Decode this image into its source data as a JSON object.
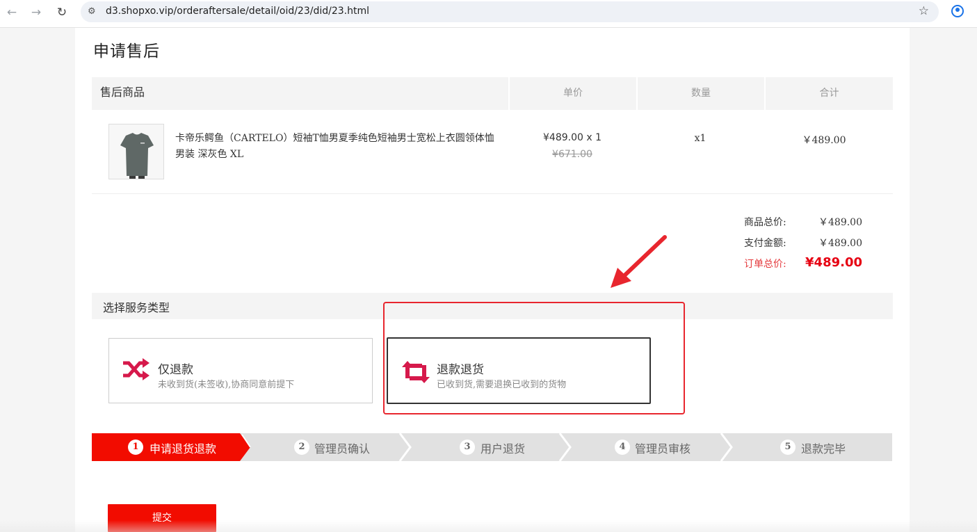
{
  "browser": {
    "url": "d3.shopxo.vip/orderaftersale/detail/oid/23/did/23.html",
    "back_icon": "arrow-left-icon",
    "forward_icon": "arrow-right-icon",
    "reload_icon": "reload-icon",
    "bookmark_icon": "star-icon",
    "profile_icon": "profile-icon"
  },
  "page": {
    "title": "申请售后"
  },
  "goods_table": {
    "headers": [
      "售后商品",
      "单价",
      "数量",
      "合计"
    ],
    "item": {
      "name": "卡帝乐鳄鱼（CARTELO）短袖T恤男夏季纯色短袖男士宽松上衣圆领体恤男装 深灰色 XL",
      "price": "¥489.00 x 1",
      "original_price": "¥671.00",
      "quantity": "x1",
      "subtotal": "￥489.00"
    }
  },
  "summary": {
    "goods_total_label": "商品总价:",
    "goods_total_value": "￥489.00",
    "paid_label": "支付金额:",
    "paid_value": "￥489.00",
    "order_total_label": "订单总价:",
    "order_total_value": "¥489.00"
  },
  "service": {
    "section_title": "选择服务类型",
    "options": [
      {
        "title": "仅退款",
        "desc": "未收到货(未签收),协商同意前提下",
        "icon": "shuffle-icon"
      },
      {
        "title": "退款退货",
        "desc": "已收到货,需要退换已收到的货物",
        "icon": "exchange-icon"
      }
    ]
  },
  "steps": [
    {
      "num": "1",
      "label": "申请退货退款"
    },
    {
      "num": "2",
      "label": "管理员确认"
    },
    {
      "num": "3",
      "label": "用户退货"
    },
    {
      "num": "4",
      "label": "管理员审核"
    },
    {
      "num": "5",
      "label": "退款完毕"
    }
  ],
  "submit_label": "提交",
  "colors": {
    "accent_red": "#f20c00",
    "price_red": "#e60012",
    "icon_crimson": "#d6194b",
    "step_gray": "#e1e1e1",
    "annotation_red": "#e8262e"
  }
}
